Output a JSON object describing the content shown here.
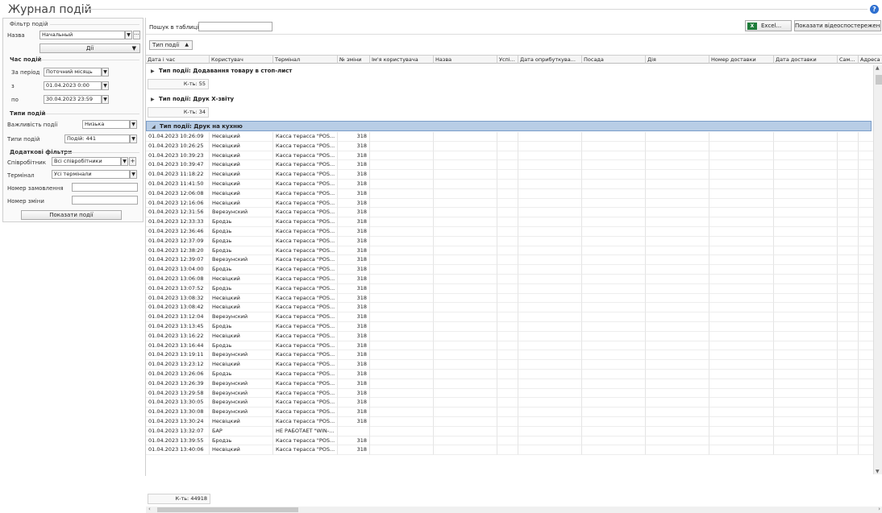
{
  "window": {
    "title": "Журнал подій",
    "help_icon": "?"
  },
  "filter": {
    "title": "Фільтр подій",
    "name_label": "Назва",
    "name_value": "Начальный",
    "more_glyph": "···",
    "actions_button": "Дії",
    "time_group": "Час подій",
    "period_label": "За період",
    "period_value": "Поточний місяць",
    "from_label": "з",
    "from_value": "01.04.2023 0:00",
    "to_label": "по",
    "to_value": "30.04.2023 23:59",
    "types_group": "Типи подій",
    "importance_label": "Важливість події",
    "importance_value": "Низька",
    "event_types_label": "Типи подій",
    "event_types_value": "Подій: 441",
    "extra_group": "Додаткові фільтри",
    "employee_label": "Співробітник",
    "employee_value": "Всі співробітники",
    "add_glyph": "+",
    "terminal_label": "Термінал",
    "terminal_value": "Усі термінали",
    "order_label": "Номер замовлення",
    "order_value": "",
    "shift_label": "Номер зміни",
    "shift_value": "",
    "show_button": "Показати події"
  },
  "toolbar": {
    "search_label": "Пошук в таблиці",
    "search_value": "",
    "excel_button": "Excel...",
    "excel_icon_glyph": "X",
    "video_button": "Показати відеоспостереження",
    "group_chip": "Тип події"
  },
  "columns": [
    "Дата і час",
    "Користувач",
    "Термінал",
    "№ зміни",
    "Ім'я користувача",
    "Назва",
    "Успі...",
    "Дата оприбуткува...",
    "Посада",
    "Дія",
    "Номер доставки",
    "Дата доставки",
    "Сам...",
    "Адреса"
  ],
  "groups": [
    {
      "label": "Тип події: Додавання товару в стоп-лист",
      "count": "К-ть: 55"
    },
    {
      "label": "Тип події: Друк Х-звіту",
      "count": "К-ть: 34"
    },
    {
      "label": "Тип події: Друк на кухню"
    }
  ],
  "rows": [
    [
      "01.04.2023 10:26:09",
      "Несвіцкий",
      "Касса терасса \"POS...",
      "318"
    ],
    [
      "01.04.2023 10:26:25",
      "Несвіцкий",
      "Касса терасса \"POS...",
      "318"
    ],
    [
      "01.04.2023 10:39:23",
      "Несвіцкий",
      "Касса терасса \"POS...",
      "318"
    ],
    [
      "01.04.2023 10:39:47",
      "Несвіцкий",
      "Касса терасса \"POS...",
      "318"
    ],
    [
      "01.04.2023 11:18:22",
      "Несвіцкий",
      "Касса терасса \"POS...",
      "318"
    ],
    [
      "01.04.2023 11:41:50",
      "Несвіцкий",
      "Касса терасса \"POS...",
      "318"
    ],
    [
      "01.04.2023 12:06:08",
      "Несвіцкий",
      "Касса терасса \"POS...",
      "318"
    ],
    [
      "01.04.2023 12:16:06",
      "Несвіцкий",
      "Касса терасса \"POS...",
      "318"
    ],
    [
      "01.04.2023 12:31:56",
      "Верезунский",
      "Касса терасса \"POS...",
      "318"
    ],
    [
      "01.04.2023 12:33:33",
      "Бродзь",
      "Касса терасса \"POS...",
      "318"
    ],
    [
      "01.04.2023 12:36:46",
      "Бродзь",
      "Касса терасса \"POS...",
      "318"
    ],
    [
      "01.04.2023 12:37:09",
      "Бродзь",
      "Касса терасса \"POS...",
      "318"
    ],
    [
      "01.04.2023 12:38:20",
      "Бродзь",
      "Касса терасса \"POS...",
      "318"
    ],
    [
      "01.04.2023 12:39:07",
      "Верезунский",
      "Касса терасса \"POS...",
      "318"
    ],
    [
      "01.04.2023 13:04:00",
      "Бродзь",
      "Касса терасса \"POS...",
      "318"
    ],
    [
      "01.04.2023 13:06:08",
      "Несвіцкий",
      "Касса терасса \"POS...",
      "318"
    ],
    [
      "01.04.2023 13:07:52",
      "Бродзь",
      "Касса терасса \"POS...",
      "318"
    ],
    [
      "01.04.2023 13:08:32",
      "Несвіцкий",
      "Касса терасса \"POS...",
      "318"
    ],
    [
      "01.04.2023 13:08:42",
      "Несвіцкий",
      "Касса терасса \"POS...",
      "318"
    ],
    [
      "01.04.2023 13:12:04",
      "Верезунский",
      "Касса терасса \"POS...",
      "318"
    ],
    [
      "01.04.2023 13:13:45",
      "Бродзь",
      "Касса терасса \"POS...",
      "318"
    ],
    [
      "01.04.2023 13:16:22",
      "Несвіцкий",
      "Касса терасса \"POS...",
      "318"
    ],
    [
      "01.04.2023 13:16:44",
      "Бродзь",
      "Касса терасса \"POS...",
      "318"
    ],
    [
      "01.04.2023 13:19:11",
      "Верезунский",
      "Касса терасса \"POS...",
      "318"
    ],
    [
      "01.04.2023 13:23:12",
      "Несвіцкий",
      "Касса терасса \"POS...",
      "318"
    ],
    [
      "01.04.2023 13:26:06",
      "Бродзь",
      "Касса терасса \"POS...",
      "318"
    ],
    [
      "01.04.2023 13:26:39",
      "Верезунский",
      "Касса терасса \"POS...",
      "318"
    ],
    [
      "01.04.2023 13:29:58",
      "Верезунский",
      "Касса терасса \"POS...",
      "318"
    ],
    [
      "01.04.2023 13:30:05",
      "Верезунский",
      "Касса терасса \"POS...",
      "318"
    ],
    [
      "01.04.2023 13:30:08",
      "Верезунский",
      "Касса терасса \"POS...",
      "318"
    ],
    [
      "01.04.2023 13:30:24",
      "Несвіцкий",
      "Касса терасса \"POS...",
      "318"
    ],
    [
      "01.04.2023 13:32:07",
      "БАР",
      "НЕ РАБОТАЕТ \"WIN-...",
      ""
    ],
    [
      "01.04.2023 13:39:55",
      "Бродзь",
      "Касса терасса \"POS...",
      "318"
    ],
    [
      "01.04.2023 13:40:06",
      "Несвіцкий",
      "Касса терасса \"POS...",
      "318"
    ]
  ],
  "footer_count": "К-ть: 44918",
  "colors": {
    "selected_group_bg": "#b8cde6",
    "excel_green": "#1e7c3a",
    "help_blue": "#2d6fd0"
  }
}
